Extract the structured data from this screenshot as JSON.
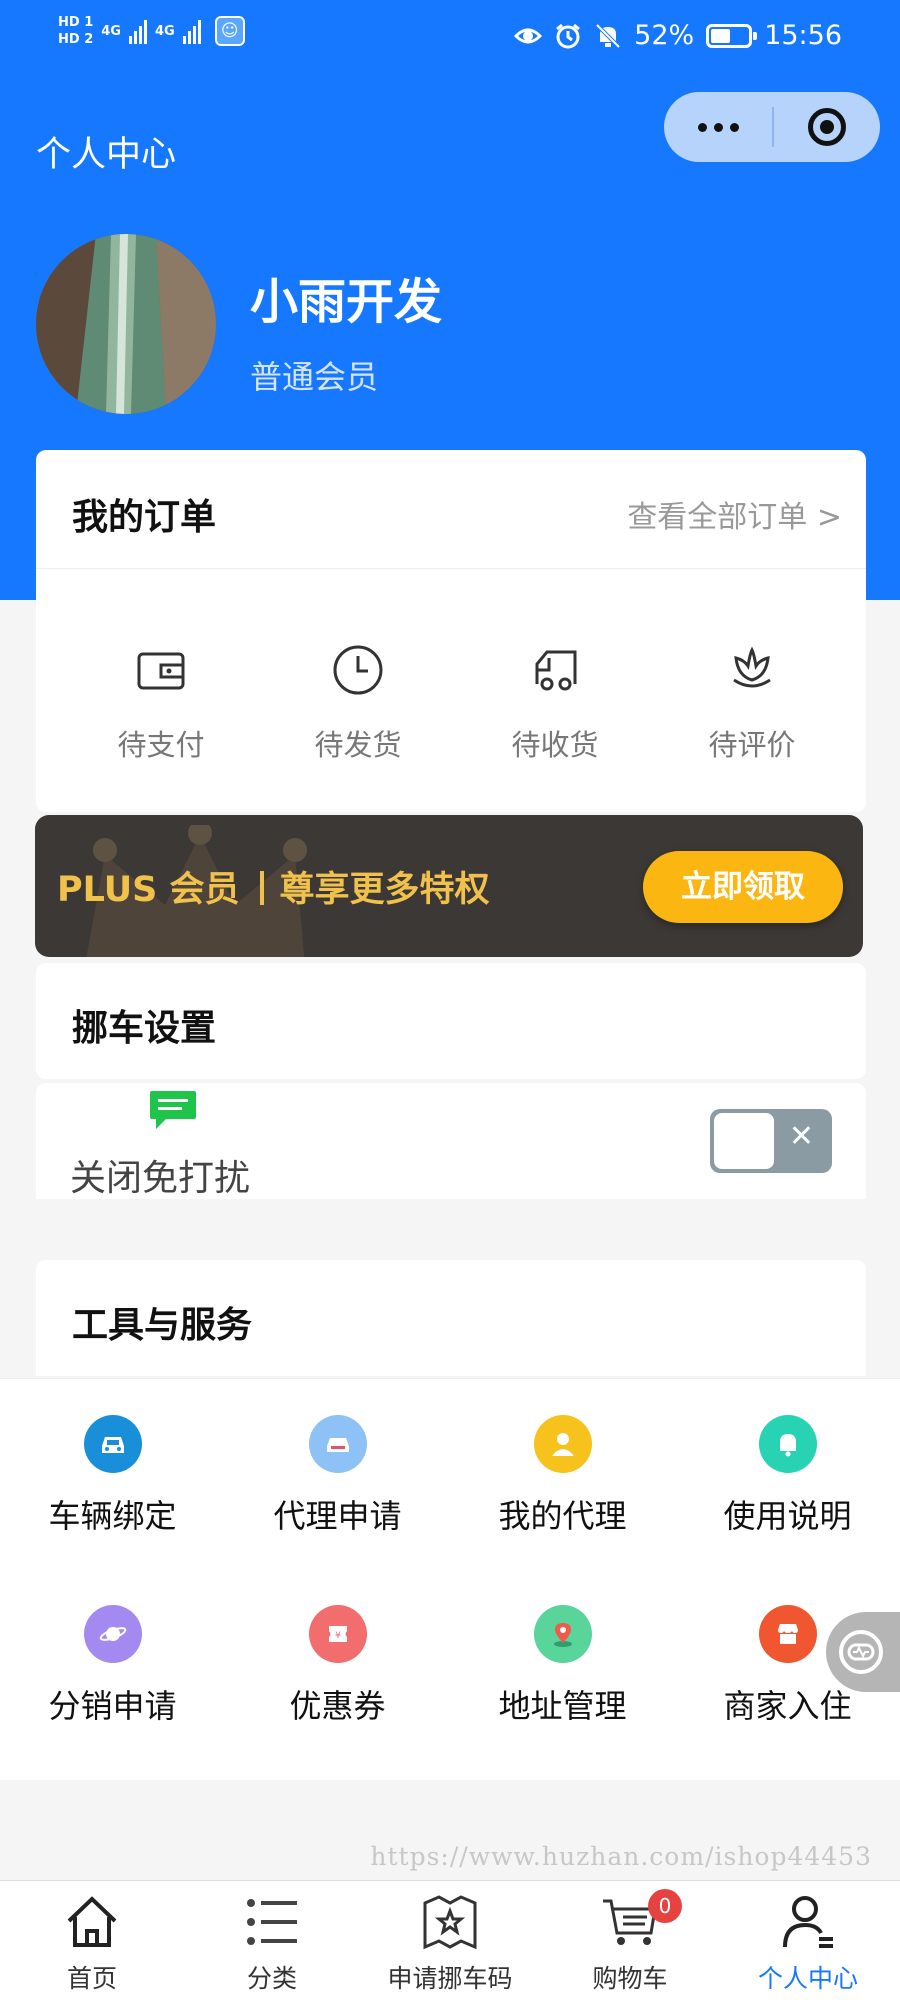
{
  "status_bar": {
    "network_1": "4G",
    "network_2": "4G",
    "battery": "52%",
    "battery_level": 0.52,
    "time": "15:56"
  },
  "nav": {
    "title": "个人中心"
  },
  "profile": {
    "name": "小雨开发",
    "level": "普通会员"
  },
  "orders": {
    "title": "我的订单",
    "see_all": "查看全部订单 >",
    "items": [
      {
        "label": "待支付",
        "icon": "wallet-icon"
      },
      {
        "label": "待发货",
        "icon": "clock-icon"
      },
      {
        "label": "待收货",
        "icon": "truck-icon"
      },
      {
        "label": "待评价",
        "icon": "flower-icon"
      }
    ]
  },
  "plus": {
    "brand": "PLUS 会员",
    "slogan": "尊享更多特权",
    "button": "立即领取"
  },
  "move_car": {
    "title": "挪车设置",
    "dnd_label": "关闭免打扰",
    "dnd_enabled": false
  },
  "tools": {
    "title": "工具与服务",
    "items": [
      {
        "label": "车辆绑定",
        "icon": "car-icon",
        "color": "#1a8fd9"
      },
      {
        "label": "代理申请",
        "icon": "agent-car-icon",
        "color": "#8ec1f5"
      },
      {
        "label": "我的代理",
        "icon": "agent-person-icon",
        "color": "#f7c21b"
      },
      {
        "label": "使用说明",
        "icon": "bell-icon",
        "color": "#28d3b4"
      },
      {
        "label": "分销申请",
        "icon": "planet-icon",
        "color": "#a48af0"
      },
      {
        "label": "优惠券",
        "icon": "coupon-icon",
        "color": "#f26d6d"
      },
      {
        "label": "地址管理",
        "icon": "location-icon",
        "color": "#59d49b"
      },
      {
        "label": "商家入住",
        "icon": "shop-icon",
        "color": "#f0562f"
      }
    ]
  },
  "watermark": "https://www.huzhan.com/ishop44453",
  "tabbar": {
    "items": [
      {
        "label": "首页",
        "icon": "home-icon"
      },
      {
        "label": "分类",
        "icon": "list-icon"
      },
      {
        "label": "申请挪车码",
        "icon": "map-star-icon"
      },
      {
        "label": "购物车",
        "icon": "cart-icon",
        "badge": "0"
      },
      {
        "label": "个人中心",
        "icon": "user-icon",
        "active": true
      }
    ]
  },
  "colors": {
    "primary": "#1677ff",
    "plus_gold": "#f0c14b",
    "plus_button": "#fbb612",
    "badge": "#e64340"
  }
}
